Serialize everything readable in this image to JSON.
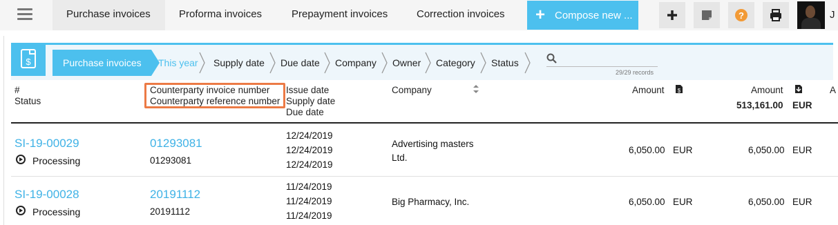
{
  "tabs": [
    "Purchase invoices",
    "Proforma invoices",
    "Prepayment invoices",
    "Correction invoices"
  ],
  "compose_label": "Compose new ...",
  "user_initial": "J",
  "breadcrumb": {
    "root": "Purchase invoices",
    "items": [
      "This year",
      "Supply date",
      "Due date",
      "Company",
      "Owner",
      "Category",
      "Status"
    ]
  },
  "search": {
    "records": "29/29 records"
  },
  "header": {
    "number": "#",
    "status": "Status",
    "cp_invoice": "Counterparty invoice number",
    "cp_reference": "Counterparty reference number",
    "issue_date": "Issue date",
    "supply_date": "Supply date",
    "due_date": "Due date",
    "company": "Company",
    "amount": "Amount",
    "amount2": "Amount",
    "total": "513,161.00",
    "total_currency": "EUR",
    "next_col": "A"
  },
  "rows": [
    {
      "number": "SI-19-00029",
      "status": "Processing",
      "cp_invoice": "01293081",
      "cp_reference": "01293081",
      "issue_date": "12/24/2019",
      "supply_date": "12/24/2019",
      "due_date": "12/24/2019",
      "company_line1": "Advertising masters",
      "company_line2": "Ltd.",
      "amount": "6,050.00",
      "currency": "EUR",
      "amount2": "6,050.00",
      "currency2": "EUR"
    },
    {
      "number": "SI-19-00028",
      "status": "Processing",
      "cp_invoice": "20191112",
      "cp_reference": "20191112",
      "issue_date": "11/24/2019",
      "supply_date": "11/24/2019",
      "due_date": "11/24/2019",
      "company_line1": "Big Pharmacy, Inc.",
      "company_line2": "",
      "amount": "6,050.00",
      "currency": "EUR",
      "amount2": "6,050.00",
      "currency2": "EUR"
    }
  ],
  "colors": {
    "accent": "#4cc0ee",
    "highlight": "#ec7a45",
    "help": "#f29a36"
  }
}
